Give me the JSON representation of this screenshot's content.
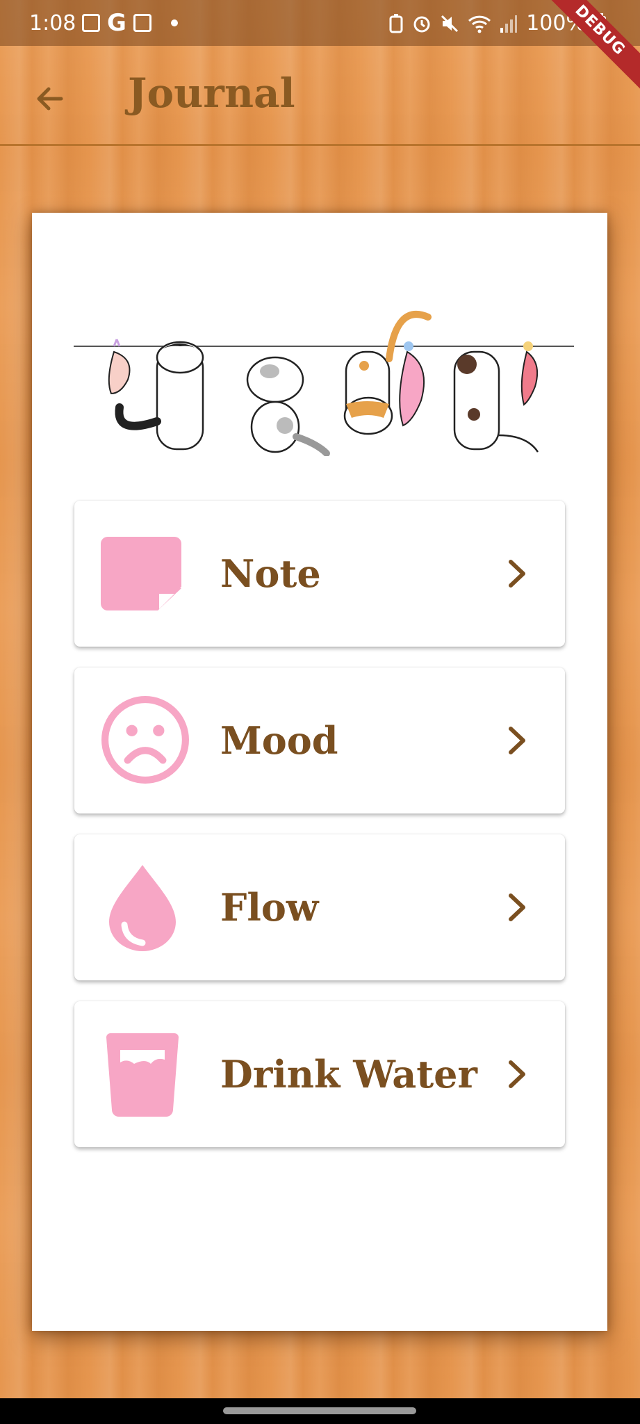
{
  "status_bar": {
    "time": "1:08",
    "battery": "100%",
    "left_icons": [
      "image-icon",
      "google-icon",
      "calendar-icon",
      "dot-icon"
    ],
    "right_icons": [
      "battery-saver-icon",
      "alarm-icon",
      "mute-icon",
      "wifi-icon",
      "signal-icon",
      "battery-icon"
    ],
    "debug_banner": "DEBUG"
  },
  "app_bar": {
    "title": "Journal",
    "back_icon": "arrow-left-icon"
  },
  "menu": {
    "items": [
      {
        "label": "Note",
        "icon": "sticky-note-icon"
      },
      {
        "label": "Mood",
        "icon": "sad-face-icon"
      },
      {
        "label": "Flow",
        "icon": "drop-icon"
      },
      {
        "label": "Drink Water",
        "icon": "water-glass-icon"
      }
    ]
  },
  "colors": {
    "accent_pink": "#f7a6c5",
    "text_brown": "#7a4f20",
    "title_brown": "#8a5a22",
    "wood": "#ea9a52",
    "debug_red": "#b42a2a"
  }
}
